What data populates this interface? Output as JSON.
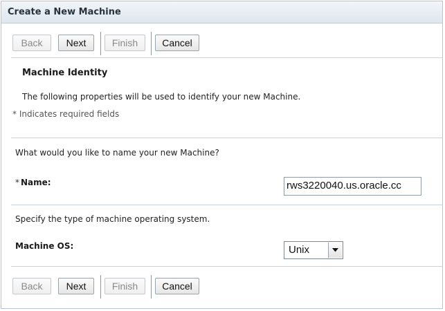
{
  "window": {
    "title": "Create a New Machine"
  },
  "toolbar": {
    "back": "Back",
    "next": "Next",
    "finish": "Finish",
    "cancel": "Cancel"
  },
  "identity": {
    "heading": "Machine Identity",
    "description": "The following properties will be used to identify your new Machine.",
    "required_note": "* Indicates required fields"
  },
  "name_section": {
    "prompt": "What would you like to name your new Machine?",
    "required_marker": "*",
    "label": "Name:",
    "value": "rws3220040.us.oracle.cc"
  },
  "os_section": {
    "prompt": "Specify the type of machine operating system.",
    "label": "Machine OS:",
    "selected": "Unix",
    "dropdown_icon": "chevron-down-icon"
  },
  "colors": {
    "title_bar": "#e6ecf2",
    "separator": "#c9d1da",
    "text": "#1a1a1a"
  }
}
